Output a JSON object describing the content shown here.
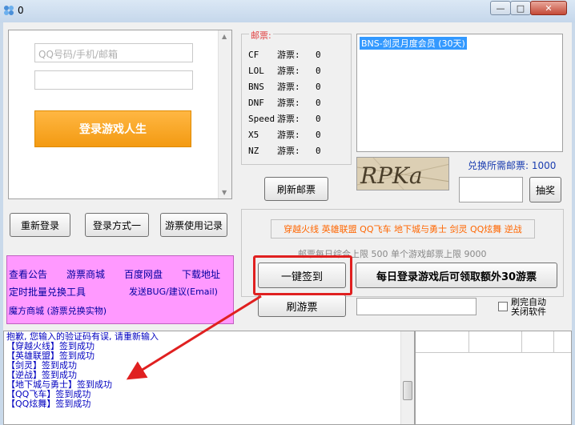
{
  "window": {
    "title": "0",
    "min_glyph": "—",
    "max_glyph": "□",
    "close_glyph": "✕"
  },
  "login": {
    "account_placeholder": "QQ号码/手机/邮箱",
    "login_button": "登录游戏人生"
  },
  "buttons": {
    "relogin": "重新登录",
    "login_mode": "登录方式一",
    "ticket_record": "游票使用记录",
    "refresh_coupon": "刷新邮票",
    "lottery": "抽奖",
    "one_click_sign": "一键签到",
    "daily_extra": "每日登录游戏后可领取额外30游票",
    "refresh_ticket": "刷游票"
  },
  "links": {
    "announcement": "查看公告",
    "ticket_mall": "游票商城",
    "baidu_disk": "百度网盘",
    "download": "下载地址",
    "batch_exchange": "定时批量兑换工具",
    "report_bug": "发送BUG/建议(Email)",
    "magic_mall": "魔方商城 (游票兑换实物)"
  },
  "coupons": {
    "legend": "邮票:",
    "rows": [
      {
        "game": "CF",
        "label": "游票:",
        "count": "0"
      },
      {
        "game": "LOL",
        "label": "游票:",
        "count": "0"
      },
      {
        "game": "BNS",
        "label": "游票:",
        "count": "0"
      },
      {
        "game": "DNF",
        "label": "游票:",
        "count": "0"
      },
      {
        "game": "Speed",
        "label": "游票:",
        "count": "0"
      },
      {
        "game": "X5",
        "label": "游票:",
        "count": "0"
      },
      {
        "game": "NZ",
        "label": "游票:",
        "count": "0"
      }
    ]
  },
  "member_list": {
    "selected": "BNS-剑灵月度会员 (30天)"
  },
  "captcha": {
    "text": "RPKa"
  },
  "exchange": {
    "need_label": "兑换所需邮票:",
    "need_value": "1000"
  },
  "games_line": "穿越火线 英雄联盟 QQ飞车 地下城与勇士 剑灵 QQ炫舞 逆战",
  "limit_text": "邮票每日综合上限 500 单个游戏邮票上限 9000",
  "auto_close": {
    "line1": "刷完自动",
    "line2": "关闭软件"
  },
  "log": [
    "抱歉, 您输入的验证码有误, 请重新输入",
    "【穿越火线】签到成功",
    "【英雄联盟】签到成功",
    "【剑灵】签到成功",
    "【逆战】签到成功",
    "【地下城与勇士】签到成功",
    "【QQ飞车】签到成功",
    "【QQ炫舞】签到成功"
  ],
  "colors": {
    "link_panel": "#ff99ff",
    "link_text": "#0000a0",
    "login_orange": "#f39a12",
    "highlight_red": "#e02020",
    "games_orange": "#ff6600",
    "log_text": "#0000c0"
  }
}
